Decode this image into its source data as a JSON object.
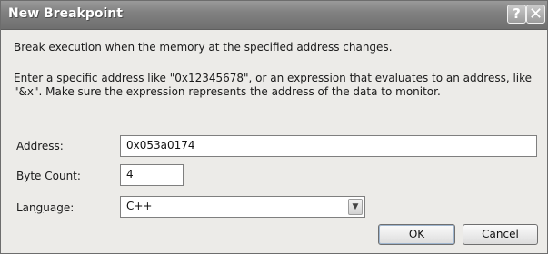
{
  "window": {
    "title": "New Breakpoint",
    "help_glyph": "?",
    "close_glyph": "✕"
  },
  "description": {
    "line1": "Break execution when the memory at the specified address changes.",
    "line2": "Enter a specific address like \"0x12345678\", or an expression that evaluates to an address, like",
    "line3": "\"&x\". Make sure the expression represents the address of the data to monitor."
  },
  "fields": {
    "address": {
      "label_mnemonic": "A",
      "label_rest": "ddress:",
      "value": "0x053a0174"
    },
    "byte_count": {
      "label_mnemonic": "B",
      "label_rest": "yte Count:",
      "value": "4"
    },
    "language": {
      "label_pre": "Lan",
      "label_mnemonic": "g",
      "label_rest": "uage:",
      "value": "C++"
    }
  },
  "buttons": {
    "ok": "OK",
    "cancel": "Cancel"
  },
  "icons": {
    "dropdown": "chevron-down-icon",
    "help": "help-icon",
    "close": "close-icon"
  }
}
